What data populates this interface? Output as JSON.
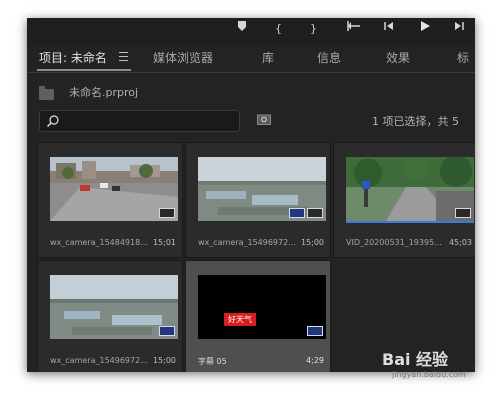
{
  "topbar": {
    "icons": [
      "marker-icon",
      "in-point-icon",
      "out-point-icon",
      "go-to-in-icon",
      "step-back-icon",
      "play-icon",
      "step-forward-icon"
    ]
  },
  "tabs": [
    {
      "label": "项目: 未命名",
      "active": true
    },
    {
      "label": "媒体浏览器",
      "active": false
    },
    {
      "label": "库",
      "active": false
    },
    {
      "label": "信息",
      "active": false
    },
    {
      "label": "效果",
      "active": false
    },
    {
      "label": "标",
      "active": false
    }
  ],
  "project": {
    "name": "未命名.prproj"
  },
  "search": {
    "placeholder": ""
  },
  "selection": {
    "text": "1 项已选择，共 5"
  },
  "items": [
    {
      "name": "wx_camera_15484918...",
      "duration": "15;01",
      "selected": false
    },
    {
      "name": "wx_camera_15496972...",
      "duration": "15;00",
      "selected": false
    },
    {
      "name": "VID_20200531_19395...",
      "duration": "45;03",
      "selected": false
    },
    {
      "name": "wx_camera_15496972...",
      "duration": "15;00",
      "selected": false
    },
    {
      "name": "字幕 05",
      "duration": "4;29",
      "selected": true,
      "caption": "好天气"
    }
  ],
  "watermark": {
    "brand": "Bai 经验",
    "url": "jingyan.baidu.com"
  },
  "colors": {
    "panel": "#232323",
    "accent": "#3b7bd7",
    "caption_red": "#d81f1f"
  }
}
